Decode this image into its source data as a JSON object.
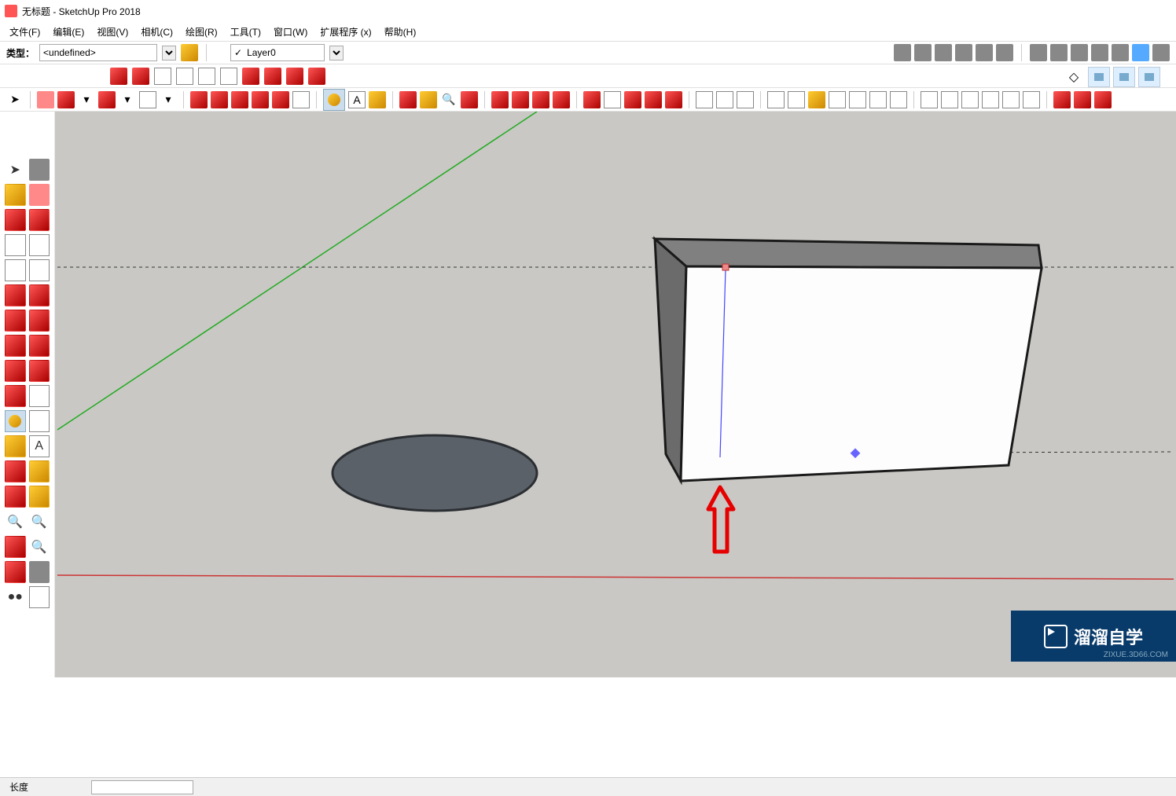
{
  "title": "无标题 - SketchUp Pro 2018",
  "menu": {
    "file": "文件(F)",
    "edit": "编辑(E)",
    "view": "视图(V)",
    "camera": "相机(C)",
    "draw": "绘图(R)",
    "tools": "工具(T)",
    "window": "窗口(W)",
    "ext": "扩展程序 (x)",
    "help": "帮助(H)"
  },
  "type_label": "类型：",
  "type_value": "<undefined>",
  "layer_value": "Layer0",
  "status": {
    "label": "长度",
    "value": ""
  },
  "watermark": {
    "brand": "溜溜自学",
    "url": "ZIXUE.3D66.COM"
  }
}
